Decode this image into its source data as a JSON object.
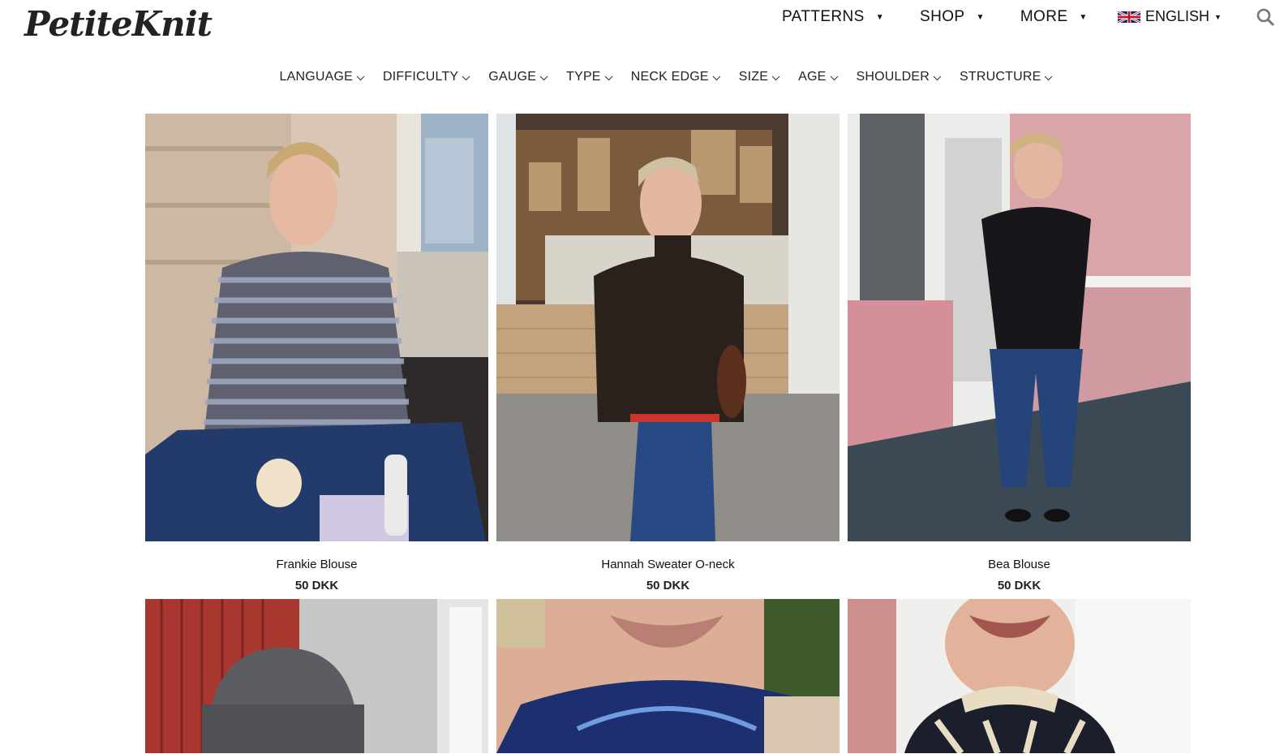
{
  "header": {
    "logo_text": "PetiteKnit",
    "nav": [
      {
        "label": "PATTERNS"
      },
      {
        "label": "SHOP"
      },
      {
        "label": "MORE"
      }
    ],
    "language": {
      "label": "ENGLISH",
      "flag": "uk-flag-icon"
    },
    "search_icon": "search-icon"
  },
  "filters": [
    {
      "label": "LANGUAGE"
    },
    {
      "label": "DIFFICULTY"
    },
    {
      "label": "GAUGE"
    },
    {
      "label": "TYPE"
    },
    {
      "label": "NECK EDGE"
    },
    {
      "label": "SIZE"
    },
    {
      "label": "AGE"
    },
    {
      "label": "SHOULDER"
    },
    {
      "label": "STRUCTURE"
    }
  ],
  "products": [
    {
      "name": "Frankie Blouse",
      "price": "50 DKK"
    },
    {
      "name": "Hannah Sweater O-neck",
      "price": "50 DKK"
    },
    {
      "name": "Bea Blouse",
      "price": "50 DKK"
    }
  ],
  "colors": {
    "text": "#111111",
    "background": "#ffffff"
  }
}
